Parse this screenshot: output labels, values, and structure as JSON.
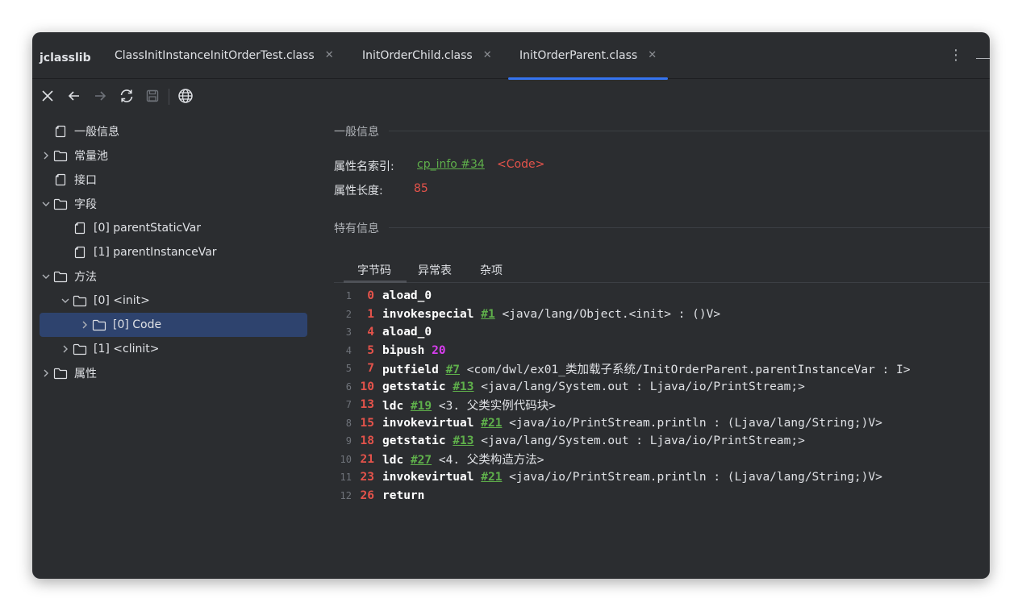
{
  "app": {
    "title": "jclasslib"
  },
  "tabs": [
    {
      "label": "ClassInitInstanceInitOrderTest.class",
      "active": false
    },
    {
      "label": "InitOrderChild.class",
      "active": false
    },
    {
      "label": "InitOrderParent.class",
      "active": true
    }
  ],
  "toolbar": {
    "icons": [
      "close-icon",
      "back-arrow-icon",
      "forward-arrow-icon",
      "refresh-icon",
      "save-icon",
      "browser-globe-icon"
    ]
  },
  "tree": [
    {
      "label": "一般信息",
      "icon": "file-icon",
      "chevron": "none"
    },
    {
      "label": "常量池",
      "icon": "folder-icon",
      "chevron": "right"
    },
    {
      "label": "接口",
      "icon": "file-icon",
      "chevron": "none"
    },
    {
      "label": "字段",
      "icon": "folder-icon",
      "chevron": "down"
    },
    {
      "label": "[0] parentStaticVar",
      "icon": "file-icon",
      "chevron": "none"
    },
    {
      "label": "[1] parentInstanceVar",
      "icon": "file-icon",
      "chevron": "none"
    },
    {
      "label": "方法",
      "icon": "folder-icon",
      "chevron": "down"
    },
    {
      "label": "[0] <init>",
      "icon": "folder-icon",
      "chevron": "down"
    },
    {
      "label": "[0] Code",
      "icon": "folder-icon",
      "chevron": "right",
      "selected": true
    },
    {
      "label": "[1] <clinit>",
      "icon": "folder-icon",
      "chevron": "right"
    },
    {
      "label": "属性",
      "icon": "folder-icon",
      "chevron": "right"
    }
  ],
  "general_info": {
    "heading": "一般信息",
    "name_index_label": "属性名索引:",
    "name_index_link": "cp_info #34",
    "name_index_value": "<Code>",
    "length_label": "属性长度:",
    "length_value": "85"
  },
  "specific_info": {
    "heading": "特有信息",
    "subtabs": [
      {
        "label": "字节码",
        "active": true
      },
      {
        "label": "异常表",
        "active": false
      },
      {
        "label": "杂项",
        "active": false
      }
    ]
  },
  "bytecode": [
    {
      "line": "1",
      "offset": "0",
      "instr": "aload_0",
      "arg": "",
      "arg_type": "",
      "comment": ""
    },
    {
      "line": "2",
      "offset": "1",
      "instr": "invokespecial",
      "arg": "#1",
      "arg_type": "link",
      "comment": "<java/lang/Object.<init> : ()V>"
    },
    {
      "line": "3",
      "offset": "4",
      "instr": "aload_0",
      "arg": "",
      "arg_type": "",
      "comment": ""
    },
    {
      "line": "4",
      "offset": "5",
      "instr": "bipush",
      "arg": "20",
      "arg_type": "num",
      "comment": ""
    },
    {
      "line": "5",
      "offset": "7",
      "instr": "putfield",
      "arg": "#7",
      "arg_type": "link",
      "comment": "<com/dwl/ex01_类加载子系统/InitOrderParent.parentInstanceVar : I>"
    },
    {
      "line": "6",
      "offset": "10",
      "instr": "getstatic",
      "arg": "#13",
      "arg_type": "link",
      "comment": "<java/lang/System.out : Ljava/io/PrintStream;>"
    },
    {
      "line": "7",
      "offset": "13",
      "instr": "ldc",
      "arg": "#19",
      "arg_type": "link",
      "comment": "<3. 父类实例代码块>"
    },
    {
      "line": "8",
      "offset": "15",
      "instr": "invokevirtual",
      "arg": "#21",
      "arg_type": "link",
      "comment": "<java/io/PrintStream.println : (Ljava/lang/String;)V>"
    },
    {
      "line": "9",
      "offset": "18",
      "instr": "getstatic",
      "arg": "#13",
      "arg_type": "link",
      "comment": "<java/lang/System.out : Ljava/io/PrintStream;>"
    },
    {
      "line": "10",
      "offset": "21",
      "instr": "ldc",
      "arg": "#27",
      "arg_type": "link",
      "comment": "<4. 父类构造方法>"
    },
    {
      "line": "11",
      "offset": "23",
      "instr": "invokevirtual",
      "arg": "#21",
      "arg_type": "link",
      "comment": "<java/io/PrintStream.println : (Ljava/lang/String;)V>"
    },
    {
      "line": "12",
      "offset": "26",
      "instr": "return",
      "arg": "",
      "arg_type": "",
      "comment": ""
    }
  ],
  "colors": {
    "accent": "#3574f0",
    "link_green": "#5fb04b",
    "offset_red": "#e5534b",
    "number_magenta": "#d93df0",
    "selection": "#2e436e"
  }
}
